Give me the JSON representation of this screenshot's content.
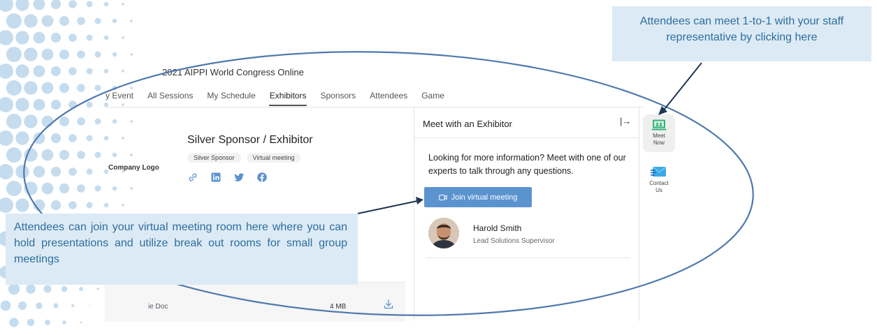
{
  "app": {
    "title": "2021 AIPPI World Congress Online"
  },
  "nav": {
    "items": [
      "y Event",
      "All Sessions",
      "My Schedule",
      "Exhibitors",
      "Sponsors",
      "Attendees",
      "Game"
    ],
    "active": "Exhibitors"
  },
  "exhibitor": {
    "logo_text": "Company Logo",
    "title": "Silver Sponsor / Exhibitor",
    "tags": [
      "Silver Sponsor",
      "Virtual meeting"
    ],
    "social_icons": [
      "link-icon",
      "linkedin-icon",
      "twitter-icon",
      "facebook-icon"
    ]
  },
  "document": {
    "name": "ie Doc",
    "size": "4 MB",
    "icon": "download-icon"
  },
  "meet_panel": {
    "heading": "Meet with an Exhibitor",
    "collapse_glyph": "|→",
    "description": "Looking for more information? Meet with one of our experts to talk through any questions.",
    "join_button": "Join virtual meeting",
    "rep": {
      "name": "Harold Smith",
      "title": "Lead Solutions Supervisor"
    }
  },
  "rail": {
    "meet_now": "Meet Now",
    "contact_us": "Contact Us"
  },
  "callouts": {
    "top": "Attendees can meet 1-to-1 with your staff representative by clicking here",
    "left": "Attendees can join your virtual meeting room here where you can hold presentations and utilize break out rooms for small group meetings"
  },
  "colors": {
    "accent": "#5b93cf",
    "callout_text": "#2d6e9e",
    "callout_bg": "#dceaf5",
    "dots": "#c5dcef"
  }
}
